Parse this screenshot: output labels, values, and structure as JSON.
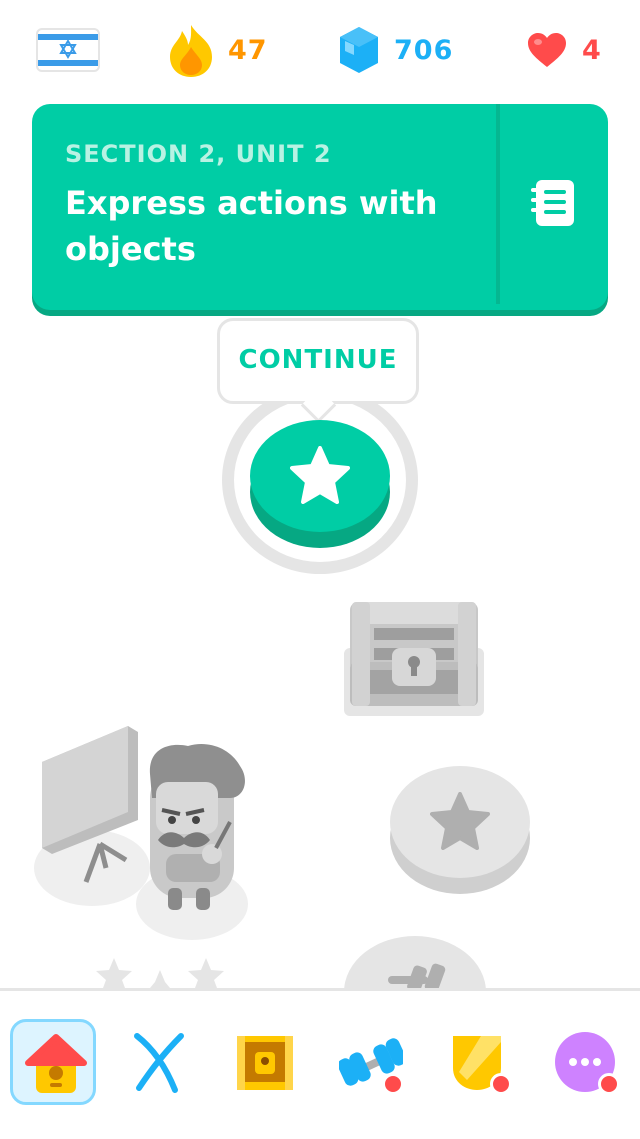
{
  "stats": {
    "course_flag": "israel-flag",
    "streak": "47",
    "gems": "706",
    "hearts": "4",
    "streak_color": "#ff9600",
    "gems_color": "#1cb0f6",
    "hearts_color": "#ff4b4b"
  },
  "unit": {
    "section": "SECTION 2, UNIT 2",
    "title": "Express actions with objects",
    "guide_icon": "guidebook-icon",
    "color": "#00cda5"
  },
  "path": {
    "continue_label": "CONTINUE",
    "nodes": [
      {
        "type": "lesson",
        "state": "active",
        "icon": "star-icon"
      },
      {
        "type": "chest",
        "state": "locked",
        "icon": "treasure-chest-icon"
      },
      {
        "type": "lesson",
        "state": "locked",
        "icon": "star-icon"
      },
      {
        "type": "lesson",
        "state": "locked",
        "icon": "dumbbell-icon"
      }
    ],
    "character": "character-oscar-with-easel"
  },
  "nav": {
    "items": [
      {
        "name": "home",
        "icon": "home-icon",
        "active": true,
        "badge": false
      },
      {
        "name": "characters",
        "icon": "alphabet-icon",
        "active": false,
        "badge": false
      },
      {
        "name": "treasure",
        "icon": "chest-icon",
        "active": false,
        "badge": false
      },
      {
        "name": "practice",
        "icon": "dumbbell-icon",
        "active": false,
        "badge": true
      },
      {
        "name": "leaderboards",
        "icon": "shield-icon",
        "active": false,
        "badge": true
      },
      {
        "name": "more",
        "icon": "more-icon",
        "active": false,
        "badge": true
      }
    ]
  }
}
